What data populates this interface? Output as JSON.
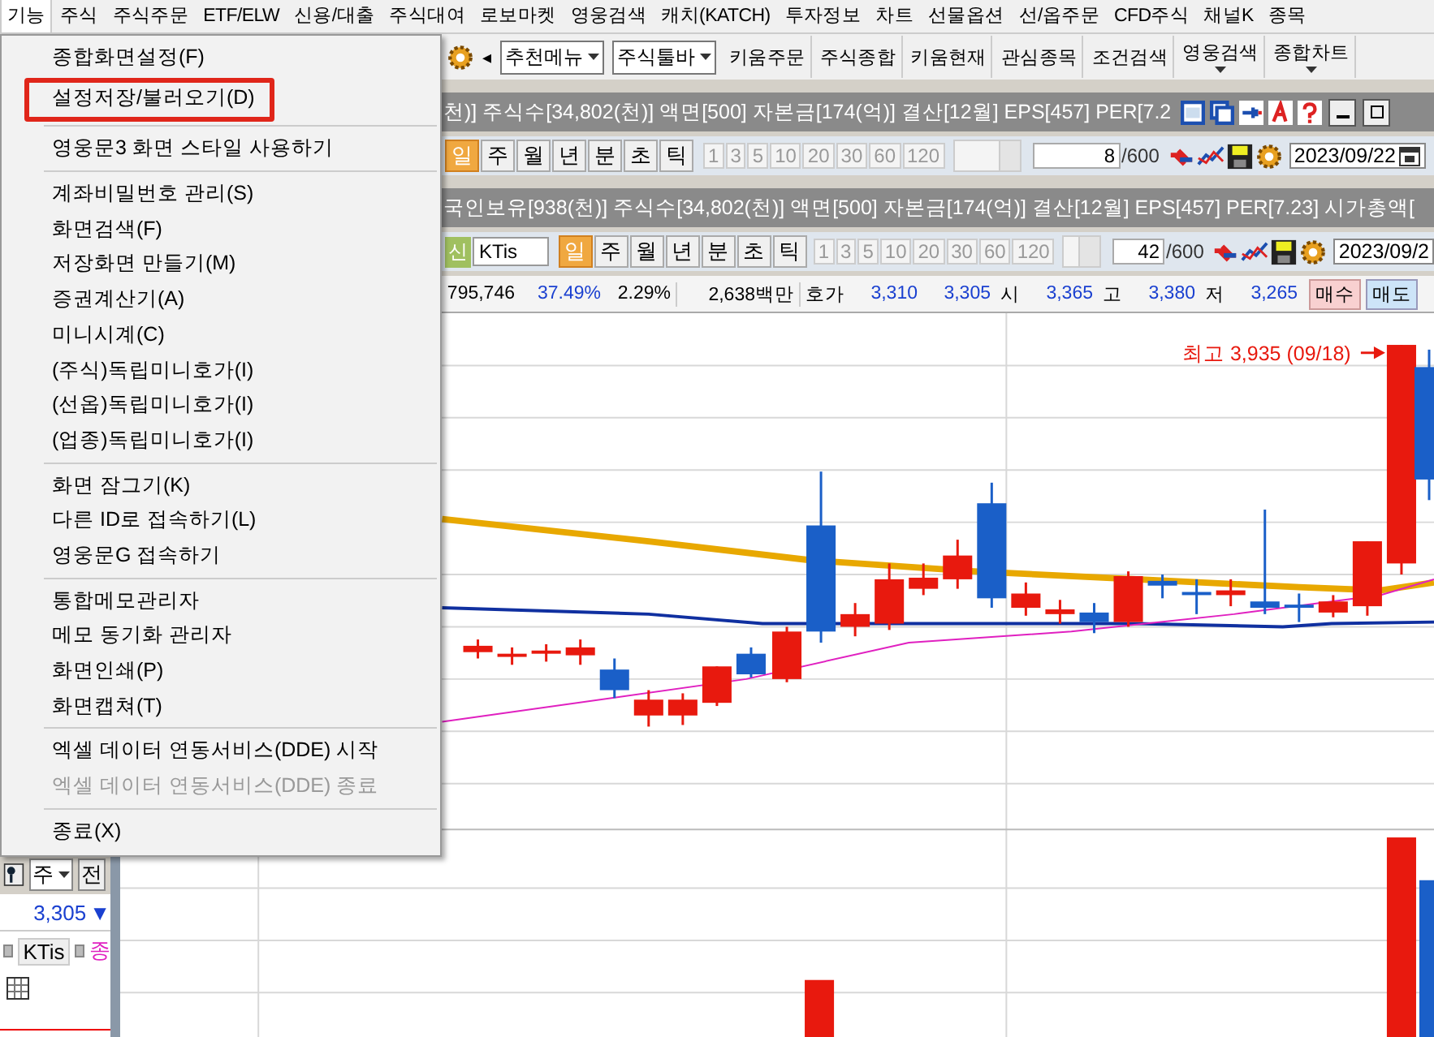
{
  "menubar": [
    {
      "label": "기능",
      "selected": true
    },
    {
      "label": "주식",
      "selected": false
    },
    {
      "label": "주식주문",
      "selected": false
    },
    {
      "label": "ETF/ELW",
      "selected": false
    },
    {
      "label": "신용/대출",
      "selected": false
    },
    {
      "label": "주식대여",
      "selected": false
    },
    {
      "label": "로보마켓",
      "selected": false
    },
    {
      "label": "영웅검색",
      "selected": false
    },
    {
      "label": "캐치(KATCH)",
      "selected": false
    },
    {
      "label": "투자정보",
      "selected": false
    },
    {
      "label": "차트",
      "selected": false
    },
    {
      "label": "선물옵션",
      "selected": false
    },
    {
      "label": "선/옵주문",
      "selected": false
    },
    {
      "label": "CFD주식",
      "selected": false
    },
    {
      "label": "채널K",
      "selected": false
    },
    {
      "label": "종목",
      "selected": false
    }
  ],
  "menu": [
    [
      {
        "label": "종합화면설정(F)",
        "selected": false,
        "disabled": false
      },
      {
        "label": "설정저장/불러오기(D)",
        "selected": true,
        "disabled": false
      }
    ],
    [
      {
        "label": "영웅문3 화면 스타일 사용하기",
        "selected": false,
        "disabled": false
      }
    ],
    [
      {
        "label": "계좌비밀번호 관리(S)",
        "selected": false,
        "disabled": false
      },
      {
        "label": "화면검색(F)",
        "selected": false,
        "disabled": false
      },
      {
        "label": "저장화면 만들기(M)",
        "selected": false,
        "disabled": false
      },
      {
        "label": "증권계산기(A)",
        "selected": false,
        "disabled": false
      },
      {
        "label": "미니시계(C)",
        "selected": false,
        "disabled": false
      },
      {
        "label": "(주식)독립미니호가(I)",
        "selected": false,
        "disabled": false
      },
      {
        "label": "(선옵)독립미니호가(I)",
        "selected": false,
        "disabled": false
      },
      {
        "label": "(업종)독립미니호가(I)",
        "selected": false,
        "disabled": false
      }
    ],
    [
      {
        "label": "화면 잠그기(K)",
        "selected": false,
        "disabled": false
      },
      {
        "label": "다른 ID로 접속하기(L)",
        "selected": false,
        "disabled": false
      },
      {
        "label": "영웅문G 접속하기",
        "selected": false,
        "disabled": false
      }
    ],
    [
      {
        "label": "통합메모관리자",
        "selected": false,
        "disabled": false
      },
      {
        "label": "메모 동기화 관리자",
        "selected": false,
        "disabled": false
      },
      {
        "label": "화면인쇄(P)",
        "selected": false,
        "disabled": false
      },
      {
        "label": "화면캡쳐(T)",
        "selected": false,
        "disabled": false
      }
    ],
    [
      {
        "label": "엑셀 데이터 연동서비스(DDE) 시작",
        "selected": false,
        "disabled": false
      },
      {
        "label": "엑셀 데이터 연동서비스(DDE) 종료",
        "selected": false,
        "disabled": true
      }
    ],
    [
      {
        "label": "종료(X)",
        "selected": false,
        "disabled": false
      }
    ]
  ],
  "toolbar": {
    "arrow": "◂",
    "dropdowns": [
      "추천메뉴",
      "주식툴바"
    ],
    "buttons": [
      {
        "label": "키움주문",
        "dropdown": false
      },
      {
        "label": "주식종합",
        "dropdown": false
      },
      {
        "label": "키움현재",
        "dropdown": false
      },
      {
        "label": "관심종목",
        "dropdown": false
      },
      {
        "label": "조건검색",
        "dropdown": false
      },
      {
        "label": "영웅검색",
        "dropdown": true
      },
      {
        "label": "종합차트",
        "dropdown": true
      }
    ]
  },
  "info_bar_1": "천)]  주식수[34,802(천)]  액면[500]  자본금[174(억)]  결산[12월]  EPS[457]  PER[7.2",
  "period_bar_1": {
    "periods": [
      {
        "label": "일",
        "selected": true
      },
      {
        "label": "주",
        "selected": false
      },
      {
        "label": "월",
        "selected": false
      },
      {
        "label": "년",
        "selected": false
      },
      {
        "label": "분",
        "selected": false
      },
      {
        "label": "초",
        "selected": false
      },
      {
        "label": "틱",
        "selected": false
      }
    ],
    "intervals": [
      "1",
      "3",
      "5",
      "10",
      "20",
      "30",
      "60",
      "120"
    ],
    "count": "8",
    "max": "/600",
    "date": "2023/09/22"
  },
  "info_bar_2": "국인보유[938(천)]  주식수[34,802(천)]  액면[500]  자본금[174(억)]  결산[12월]  EPS[457]  PER[7.23]  시가총액[",
  "period_bar_2": {
    "badge": "신",
    "stock": "KTis",
    "periods": [
      {
        "label": "일",
        "selected": true
      },
      {
        "label": "주",
        "selected": false
      },
      {
        "label": "월",
        "selected": false
      },
      {
        "label": "년",
        "selected": false
      },
      {
        "label": "분",
        "selected": false
      },
      {
        "label": "초",
        "selected": false
      },
      {
        "label": "틱",
        "selected": false
      }
    ],
    "intervals": [
      "1",
      "3",
      "5",
      "10",
      "20",
      "30",
      "60",
      "120"
    ],
    "count": "42",
    "max": "/600",
    "date": "2023/09/2"
  },
  "quote_row": {
    "volume": "795,746",
    "turnover": "37.49%",
    "change": "2.29%",
    "amount": "2,638백만",
    "ask_label": "호가",
    "ask": "3,310",
    "bid": "3,305",
    "open_label": "시",
    "open": "3,365",
    "high_label": "고",
    "high": "3,380",
    "low_label": "저",
    "low": "3,265",
    "buy": "매수",
    "sell": "매도"
  },
  "chart": {
    "annotation": "최고 3,935 (09/18)"
  },
  "left_panel": {
    "dropdown": "주",
    "button": "전",
    "price": "3,305",
    "price_arrow": "▼",
    "stock": "KTis",
    "legend": "종"
  }
}
